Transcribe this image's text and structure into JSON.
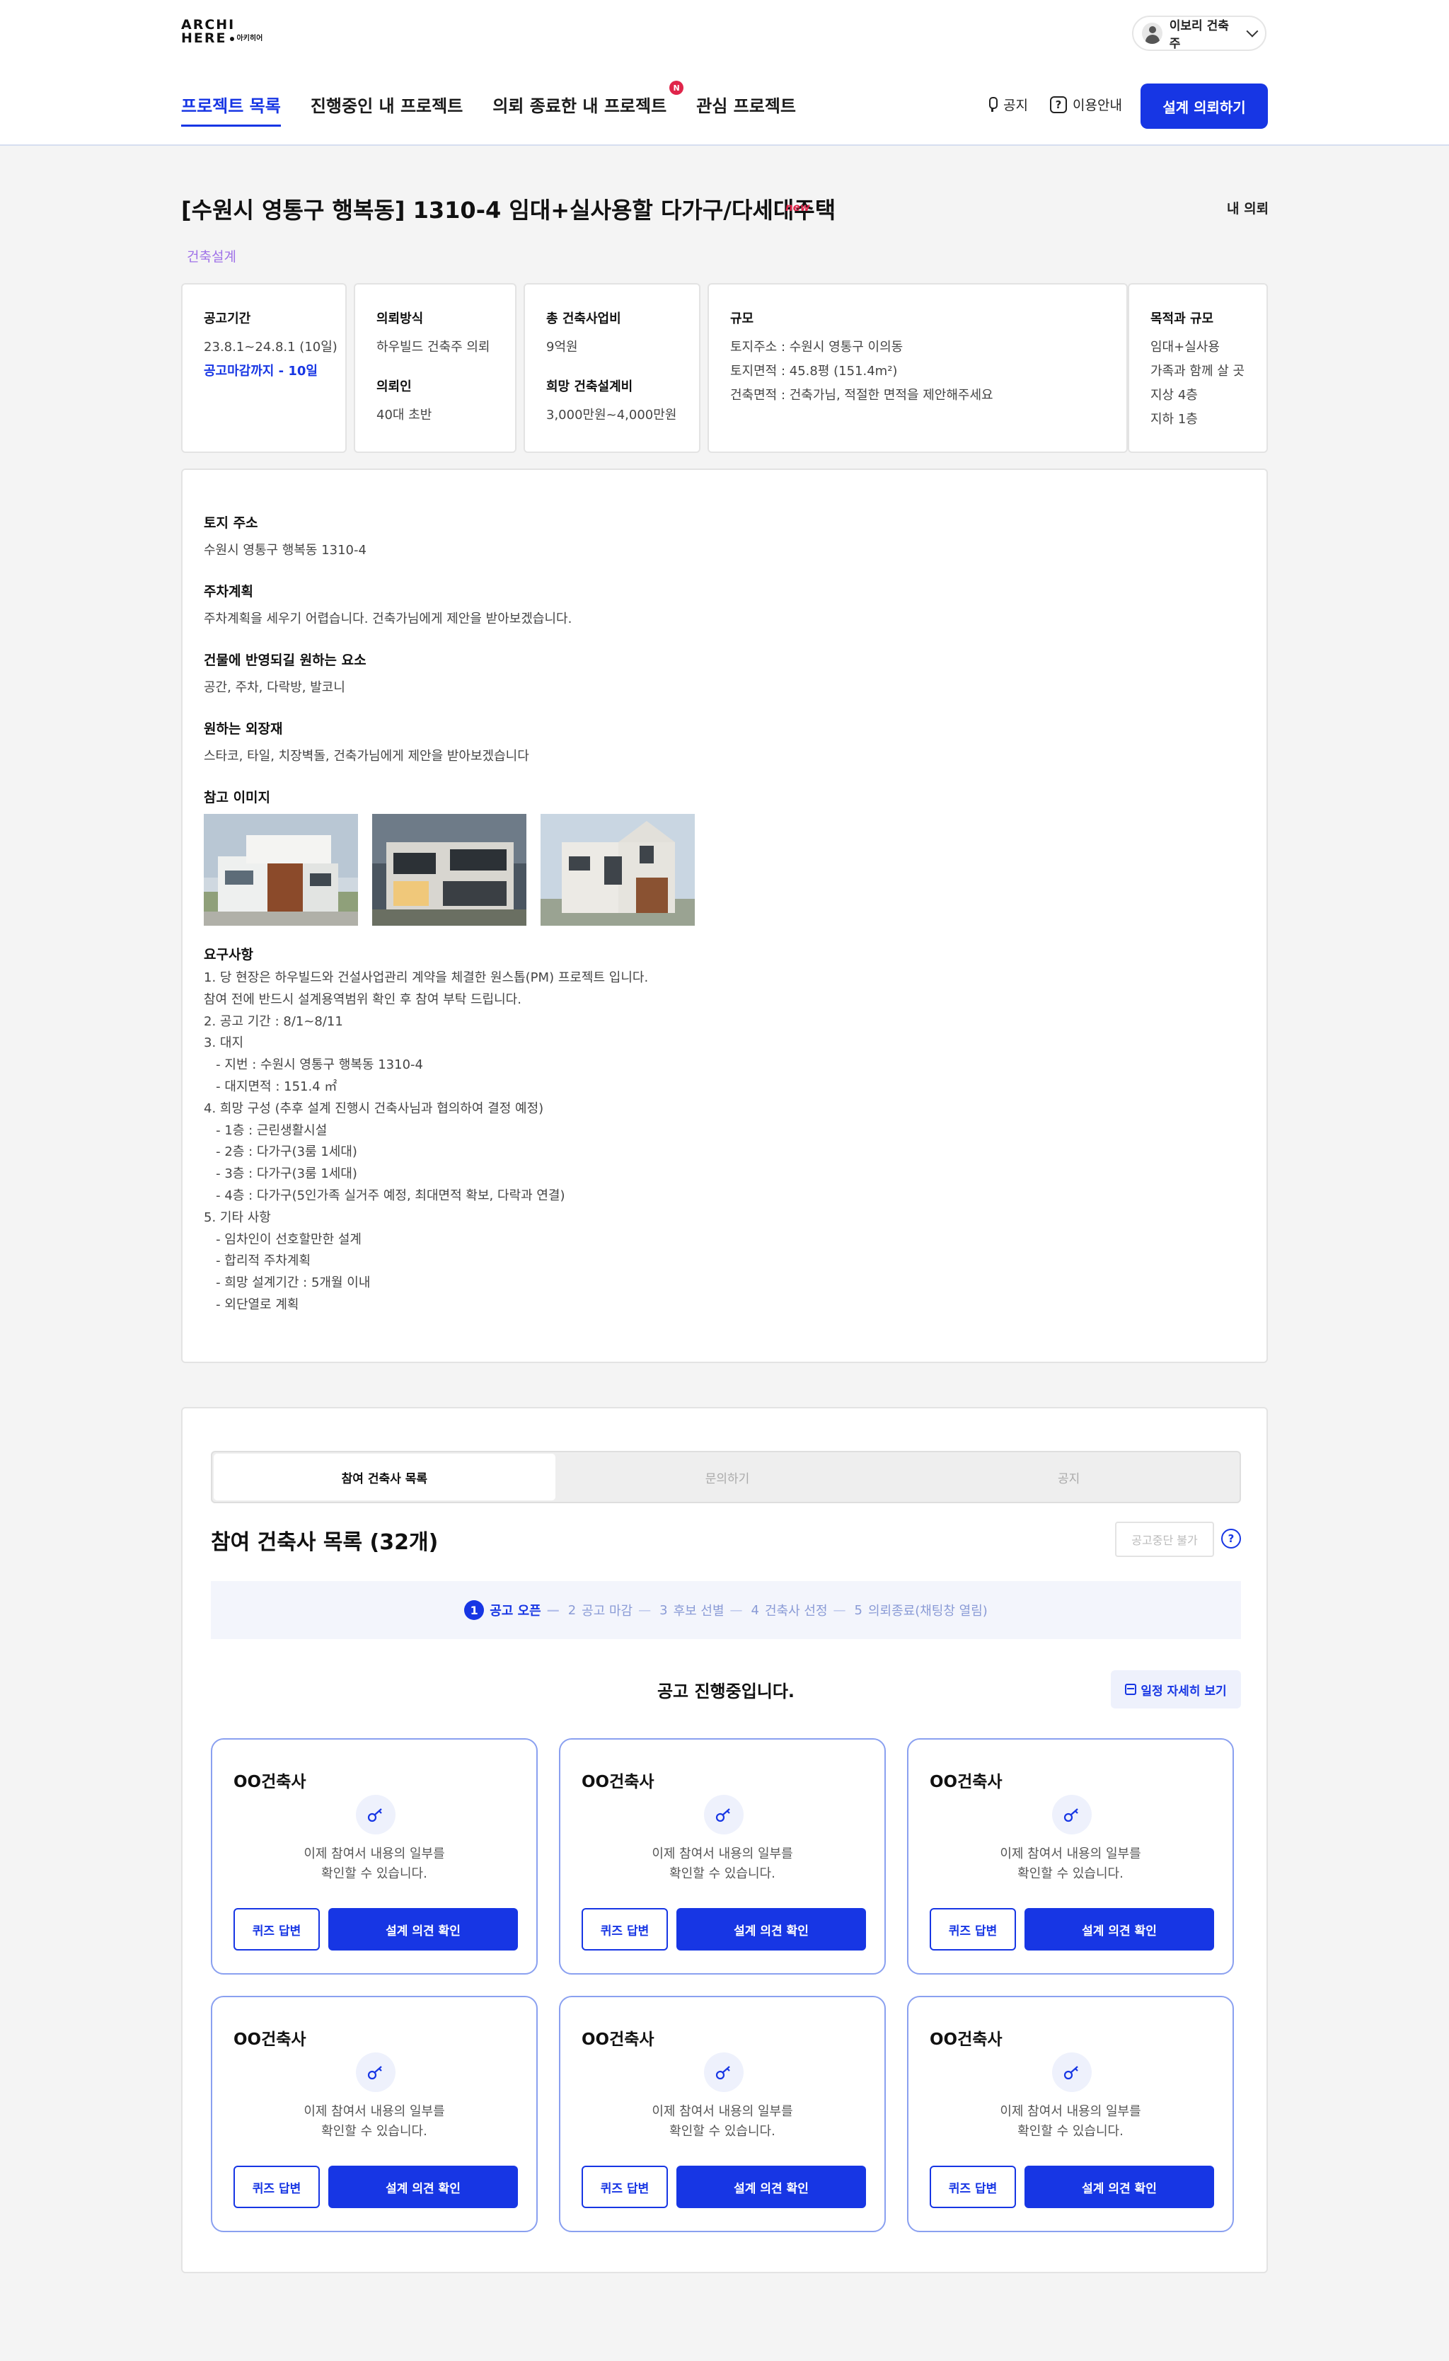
{
  "header": {
    "logo_line1": "ARCHI",
    "logo_line2": "HERE",
    "logo_sub": "아키히어",
    "user_name": "이보리 건축주",
    "nav": [
      {
        "label": "프로젝트 목록",
        "active": true
      },
      {
        "label": "진행중인 내 프로젝트"
      },
      {
        "label": "의뢰 종료한 내 프로젝트",
        "badge": "N"
      },
      {
        "label": "관심 프로젝트"
      }
    ],
    "notice_label": "공지",
    "guide_label": "이용안내",
    "cta_label": "설계 의뢰하기"
  },
  "project": {
    "title": "[수원시 영통구 행복동] 1310-4 임대+실사용할 다가구/다세대주택",
    "new_tag": "new",
    "my_request": "내 의뢰",
    "category": "건축설계",
    "period": {
      "label": "공고기간",
      "value": "23.8.1~24.8.1 (10일)",
      "deadline": "공고마감까지 - 10일"
    },
    "method": {
      "label": "의뢰방식",
      "value": "하우빌드 건축주 의뢰",
      "client_label": "의뢰인",
      "client_value": "40대 초반"
    },
    "budget": {
      "label": "총 건축사업비",
      "value": "9억원",
      "design_label": "희망 건축설계비",
      "design_value": "3,000만원~4,000만원"
    },
    "scale": {
      "label": "규모",
      "address": "토지주소 : 수원시 영통구 이의동",
      "area": "토지면적 : 45.8평 (151.4m²)",
      "building": "건축면적 : 건축가님, 적절한 면적을 제안해주세요"
    },
    "purpose": {
      "label": "목적과 규모",
      "lines": [
        "임대+실사용",
        "가족과 함께 살 곳",
        "지상 4층",
        "지하 1층"
      ]
    }
  },
  "details": {
    "land_label": "토지 주소",
    "land_value": "수원시 영통구 행복동 1310-4",
    "parking_label": "주차계획",
    "parking_value": "주차계획을 세우기 어렵습니다. 건축가님에게 제안을 받아보겠습니다.",
    "elements_label": "건물에 반영되길 원하는 요소",
    "elements_value": "공간, 주차, 다락방, 발코니",
    "exterior_label": "원하는 외장재",
    "exterior_value": "스타코, 타일, 치장벽돌, 건축가님에게 제안을 받아보겠습니다",
    "images_label": "참고 이미지",
    "requirements_label": "요구사항",
    "requirements": [
      "1. 당 현장은 하우빌드와 건설사업관리 계약을 체결한 원스톱(PM) 프로젝트 입니다.",
      "참여 전에 반드시 설계용역범위 확인 후 참여 부탁 드립니다.",
      "2. 공고 기간 : 8/1~8/11",
      "3. 대지",
      "   - 지번 : 수원시 영통구 행복동 1310-4",
      "   - 대지면적 : 151.4 ㎡",
      "4. 희망 구성 (추후 설계 진행시 건축사님과 협의하여 결정 예정)",
      "   - 1층 : 근린생활시설",
      "   - 2층 : 다가구(3룸 1세대)",
      "   - 3층 : 다가구(3룸 1세대)",
      "   - 4층 : 다가구(5인가족 실거주 예정, 최대면적 확보, 다락과 연결)",
      "5. 기타 사항",
      "   - 임차인이 선호할만한 설계",
      "   - 합리적 주차계획",
      "   - 희망 설계기간 : 5개월 이내",
      "   - 외단열로 계획"
    ]
  },
  "panel": {
    "tabs": [
      "참여 건축사 목록",
      "문의하기",
      "공지"
    ],
    "list_title": "참여 건축사 목록 (32개)",
    "stop_label": "공고중단 불가",
    "help_glyph": "?",
    "steps": [
      {
        "num": "1",
        "label": "공고 오픈"
      },
      {
        "num": "2",
        "label": "공고 마감"
      },
      {
        "num": "3",
        "label": "후보 선별"
      },
      {
        "num": "4",
        "label": "건축사 선정"
      },
      {
        "num": "5",
        "label": "의뢰종료(채팅창 열림)"
      }
    ],
    "status": "공고 진행중입니다.",
    "schedule_label": "일정 자세히 보기",
    "cards": [
      {
        "name": "OO건축사",
        "desc1": "이제 참여서 내용의 일부를",
        "desc2": "확인할 수 있습니다.",
        "quiz": "퀴즈 답변",
        "opinion": "설계 의견 확인"
      },
      {
        "name": "OO건축사",
        "desc1": "이제 참여서 내용의 일부를",
        "desc2": "확인할 수 있습니다.",
        "quiz": "퀴즈 답변",
        "opinion": "설계 의견 확인"
      },
      {
        "name": "OO건축사",
        "desc1": "이제 참여서 내용의 일부를",
        "desc2": "확인할 수 있습니다.",
        "quiz": "퀴즈 답변",
        "opinion": "설계 의견 확인"
      },
      {
        "name": "OO건축사",
        "desc1": "이제 참여서 내용의 일부를",
        "desc2": "확인할 수 있습니다.",
        "quiz": "퀴즈 답변",
        "opinion": "설계 의견 확인"
      },
      {
        "name": "OO건축사",
        "desc1": "이제 참여서 내용의 일부를",
        "desc2": "확인할 수 있습니다.",
        "quiz": "퀴즈 답변",
        "opinion": "설계 의견 확인"
      },
      {
        "name": "OO건축사",
        "desc1": "이제 참여서 내용의 일부를",
        "desc2": "확인할 수 있습니다.",
        "quiz": "퀴즈 답변",
        "opinion": "설계 의견 확인"
      }
    ]
  },
  "colors": {
    "accent": "#1736e4",
    "badge": "#e0254a",
    "category": "#a072e8",
    "card_border": "#8aa0f0"
  }
}
